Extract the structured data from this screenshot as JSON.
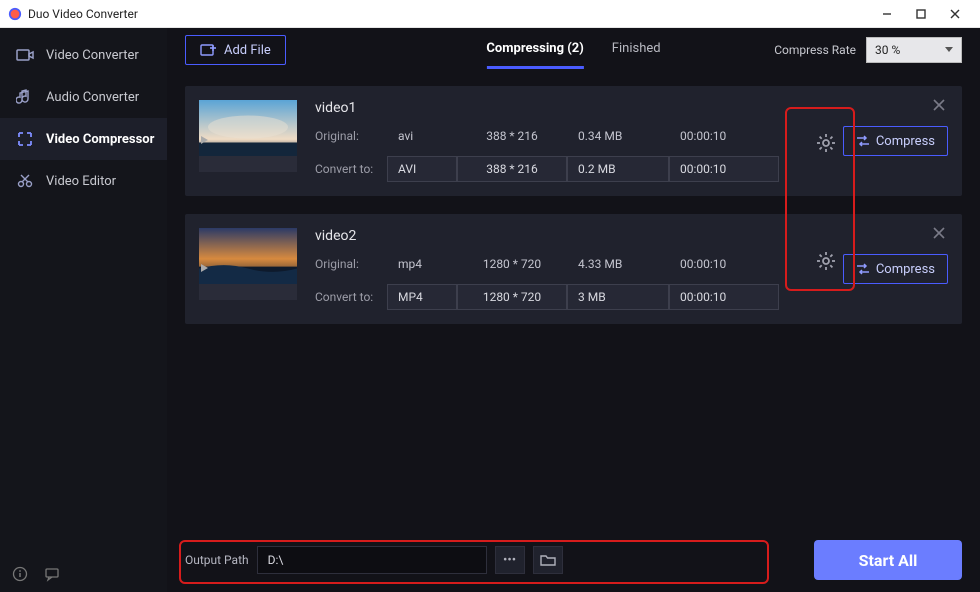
{
  "title": "Duo Video Converter",
  "sidebar": {
    "items": [
      {
        "label": "Video Converter"
      },
      {
        "label": "Audio Converter"
      },
      {
        "label": "Video Compressor"
      },
      {
        "label": "Video Editor"
      }
    ]
  },
  "header": {
    "add_file": "Add File",
    "tabs": [
      {
        "label": "Compressing (2)"
      },
      {
        "label": "Finished"
      }
    ],
    "rate_label": "Compress Rate",
    "rate_value": "30 %"
  },
  "videos": [
    {
      "name": "video1",
      "orig": {
        "fmt": "avi",
        "res": "388 * 216",
        "size": "0.34 MB",
        "dur": "00:00:10"
      },
      "conv": {
        "fmt": "AVI",
        "res": "388 * 216",
        "size": "0.2 MB",
        "dur": "00:00:10"
      },
      "orig_label": "Original:",
      "conv_label": "Convert to:",
      "compress_label": "Compress",
      "thumb_colors": {
        "sky1": "#5aa4d6",
        "sky2": "#dceaf5",
        "ground": "#13263b",
        "sun": "#ffd27a"
      }
    },
    {
      "name": "video2",
      "orig": {
        "fmt": "mp4",
        "res": "1280 * 720",
        "size": "4.33 MB",
        "dur": "00:00:10"
      },
      "conv": {
        "fmt": "MP4",
        "res": "1280 * 720",
        "size": "3 MB",
        "dur": "00:00:10"
      },
      "orig_label": "Original:",
      "conv_label": "Convert to:",
      "compress_label": "Compress",
      "thumb_colors": {
        "sky1": "#2b3a66",
        "sky2": "#d78a3f",
        "ground": "#0e1a2c",
        "sun": "#ffe0a3"
      }
    }
  ],
  "footer": {
    "output_label": "Output Path",
    "output_value": "D:\\",
    "start_all": "Start All"
  }
}
